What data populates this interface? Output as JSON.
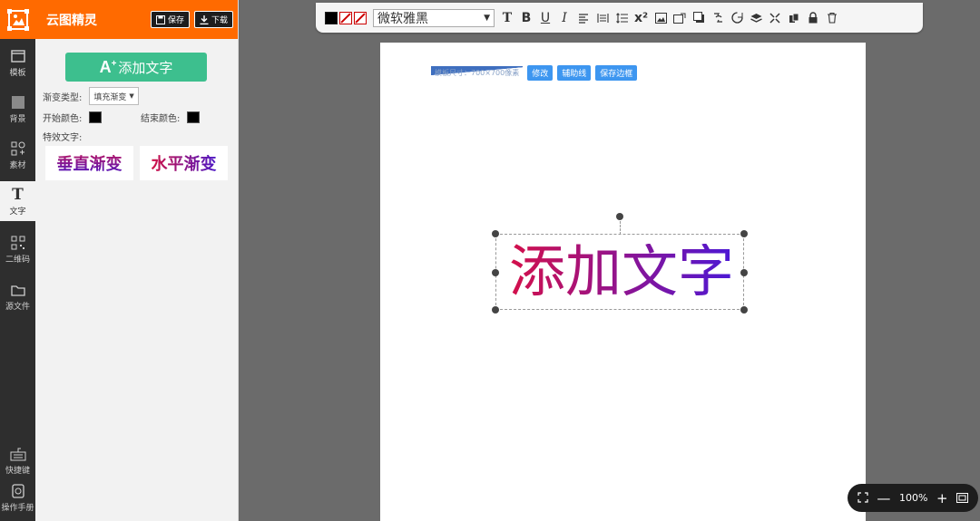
{
  "app": {
    "name": "云图精灵",
    "save_label": "保存",
    "download_label": "下载"
  },
  "rail": [
    {
      "key": "template",
      "label": "模板",
      "icon": "template-icon"
    },
    {
      "key": "background",
      "label": "背景",
      "icon": "background-icon"
    },
    {
      "key": "material",
      "label": "素材",
      "icon": "material-icon"
    },
    {
      "key": "text",
      "label": "文字",
      "icon": "text-icon"
    },
    {
      "key": "qrcode",
      "label": "二维码",
      "icon": "qrcode-icon"
    },
    {
      "key": "source",
      "label": "源文件",
      "icon": "folder-icon"
    },
    {
      "key": "shortcuts",
      "label": "快捷键",
      "icon": "keyboard-icon"
    },
    {
      "key": "manual",
      "label": "操作手册",
      "icon": "manual-icon"
    }
  ],
  "panel": {
    "add_text_label": "添加文字",
    "gradient_type_label": "渐变类型:",
    "gradient_type_value": "填充渐变",
    "start_color_label": "开始颜色:",
    "end_color_label": "结束颜色:",
    "effect_text_label": "特效文字:",
    "effects": [
      {
        "key": "vertical",
        "label": "垂直渐变"
      },
      {
        "key": "horizontal",
        "label": "水平渐变"
      }
    ],
    "start_color": "#000000",
    "end_color": "#000000",
    "accent_color": "#3dbf8e"
  },
  "toolbar": {
    "font_name": "微软雅黑",
    "superscript": "x²",
    "items": [
      "T",
      "B",
      "U",
      "I"
    ]
  },
  "canvas": {
    "size_label": "模板尺寸：700×700像素",
    "modify_label": "修改",
    "guides_label": "辅助线",
    "save_border_label": "保存边框",
    "text": "添加文字"
  },
  "zoom": {
    "level": "100%"
  },
  "colors": {
    "brand": "#ff6a00",
    "rail": "#2e2e2e",
    "blue_button": "#3d96f0"
  }
}
